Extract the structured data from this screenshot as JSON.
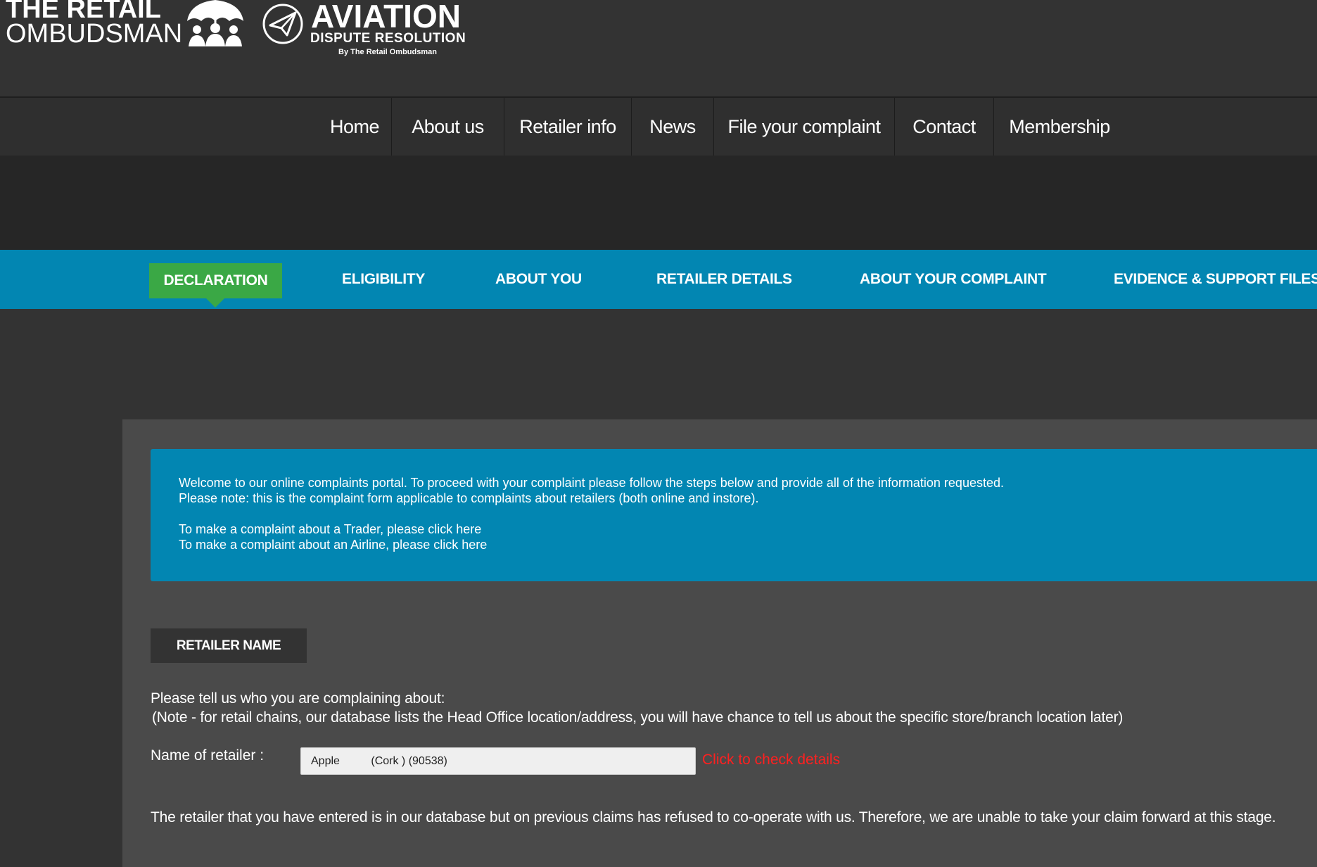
{
  "logos": {
    "retail_line1": "THE RETAIL",
    "retail_line2": "OMBUDSMAN",
    "aviation_title": "AVIATION",
    "aviation_subtitle": "DISPUTE RESOLUTION",
    "aviation_byline": "By The Retail Ombudsman"
  },
  "nav": {
    "items": [
      "Home",
      "About us",
      "Retailer info",
      "News",
      "File your complaint",
      "Contact",
      "Membership"
    ]
  },
  "steps": {
    "active": "DECLARATION",
    "items": [
      "ELIGIBILITY",
      "ABOUT YOU",
      "RETAILER DETAILS",
      "ABOUT YOUR COMPLAINT",
      "EVIDENCE & SUPPORT FILES"
    ]
  },
  "info": {
    "line1": "Welcome to our online complaints portal. To proceed with your complaint please follow the steps below and provide all of the information requested.",
    "line2": "Please note: this is the complaint form applicable to complaints about retailers (both online and instore).",
    "line3": "To make a complaint about a Trader, please click here",
    "line4": "To make a complaint about an Airline, please click here"
  },
  "form": {
    "section_title": "RETAILER NAME",
    "question": "Please tell us who you are complaining about:",
    "note": "(Note - for retail chains, our database lists the Head Office location/address, you will have chance to tell us about the specific store/branch location later)",
    "retailer_label": "Name of retailer :",
    "retailer_value": "Apple          (Cork ) (90538)",
    "check_link": "Click to check details",
    "refusal_message": "The retailer that you have entered is in our database but on previous claims has refused to co-operate with us. Therefore, we are unable to take your claim forward at this stage."
  },
  "colors": {
    "header_bg": "#333333",
    "steps_bg": "#0286b2",
    "active_step": "#3aa845",
    "panel_bg": "#4a4a4a",
    "link_red": "#ff2020"
  }
}
